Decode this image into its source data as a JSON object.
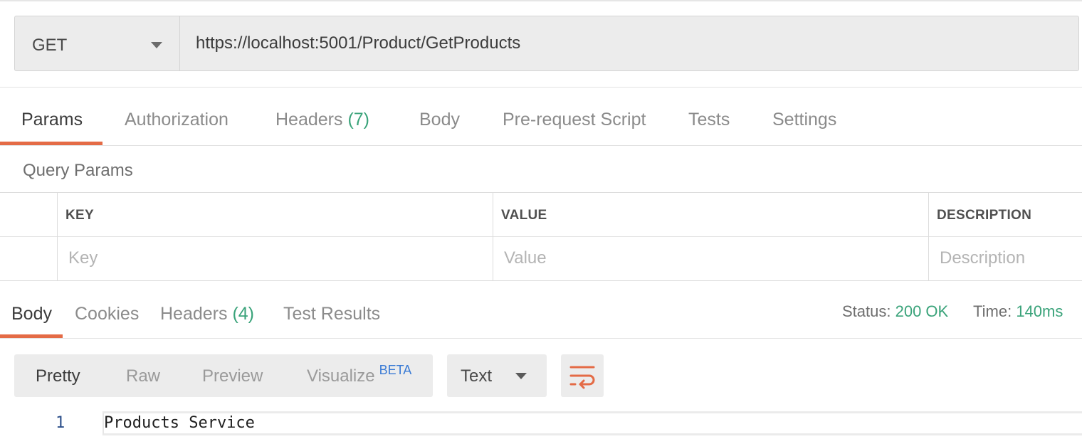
{
  "request": {
    "method": "GET",
    "url": "https://localhost:5001/Product/GetProducts"
  },
  "request_tabs": [
    {
      "label": "Params",
      "count": "",
      "active": true
    },
    {
      "label": "Authorization",
      "count": ""
    },
    {
      "label": "Headers",
      "count": "(7)"
    },
    {
      "label": "Body",
      "count": ""
    },
    {
      "label": "Pre-request Script",
      "count": ""
    },
    {
      "label": "Tests",
      "count": ""
    },
    {
      "label": "Settings",
      "count": ""
    }
  ],
  "query_params": {
    "title": "Query Params",
    "columns": [
      "KEY",
      "VALUE",
      "DESCRIPTION"
    ],
    "placeholders": [
      "Key",
      "Value",
      "Description"
    ]
  },
  "response_tabs": [
    {
      "label": "Body",
      "count": "",
      "active": true
    },
    {
      "label": "Cookies",
      "count": ""
    },
    {
      "label": "Headers",
      "count": "(4)"
    },
    {
      "label": "Test Results",
      "count": ""
    }
  ],
  "response_meta": {
    "status_label": "Status:",
    "status_value": "200 OK",
    "time_label": "Time:",
    "time_value": "140ms"
  },
  "view_modes": [
    {
      "label": "Pretty",
      "active": true
    },
    {
      "label": "Raw"
    },
    {
      "label": "Preview"
    },
    {
      "label": "Visualize",
      "badge": "BETA"
    }
  ],
  "format": {
    "selected": "Text"
  },
  "response_body": {
    "lines": [
      {
        "number": "1",
        "text": "Products Service"
      }
    ]
  },
  "colors": {
    "accent": "#e46b46",
    "success": "#3aa37a",
    "beta": "#3a7bd5"
  }
}
